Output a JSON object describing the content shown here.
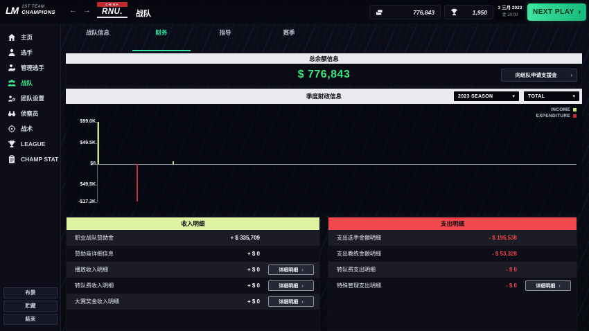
{
  "icons": {
    "chevron_right": "›",
    "chevron_down": "▾",
    "back_arrow": "←",
    "forward_arrow": "→"
  },
  "topbar": {
    "app_logo": {
      "monogram": "LM",
      "line1": "1ST TEAM",
      "line2": "CHAMPIONS"
    },
    "team": {
      "banner": "CHINA",
      "logo": "RNU.",
      "page_title": "战队"
    },
    "resources": {
      "money": "776,843",
      "tokens": "1,950"
    },
    "date": {
      "line1": "3 三月 2023",
      "line2": "金 20:00"
    },
    "next_play_label": "NEXT PLAY"
  },
  "sidebar": {
    "items": [
      {
        "label": "主页",
        "icon": "home"
      },
      {
        "label": "选手",
        "icon": "player"
      },
      {
        "label": "管理选手",
        "icon": "manage-players"
      },
      {
        "label": "战队",
        "icon": "team",
        "active": true
      },
      {
        "label": "团队设置",
        "icon": "team-settings"
      },
      {
        "label": "侦察员",
        "icon": "scout"
      },
      {
        "label": "战术",
        "icon": "tactics"
      },
      {
        "label": "LEAGUE",
        "icon": "league"
      },
      {
        "label": "CHAMP STAT",
        "icon": "champ-stat"
      }
    ],
    "footer_buttons": [
      "布景",
      "贮藏",
      "結束"
    ]
  },
  "tabs": [
    {
      "label": "战队信息",
      "active": false
    },
    {
      "label": "财务",
      "active": true
    },
    {
      "label": "指导",
      "active": false
    },
    {
      "label": "赛季",
      "active": false
    }
  ],
  "balance": {
    "header": "总余额信息",
    "amount": "$ 776,843",
    "request_button": "向组队申请支援金"
  },
  "finance_section": {
    "header": "季度财政信息",
    "season_select": "2023 SEASON",
    "scope_select": "TOTAL"
  },
  "chart_data": {
    "type": "bar",
    "title": "季度财政信息",
    "legend": [
      {
        "label": "INCOME",
        "color": "#cde37c"
      },
      {
        "label": "EXPENDITURE",
        "color": "#c22f3c"
      }
    ],
    "legend_position": "top-right",
    "y_tick_labels": [
      "$99.0K",
      "$49.5K",
      "$0",
      "$49.5K",
      "-$17.3K"
    ],
    "x_tick_labels": [],
    "grid": false,
    "bars": [
      {
        "series": "INCOME",
        "x_frac": 0.002,
        "height_frac": 1.0,
        "approx_value": 99000
      },
      {
        "series": "EXPENDITURE",
        "x_frac": 0.083,
        "height_frac": -1.0,
        "approx_value": -173000
      },
      {
        "series": "INCOME",
        "x_frac": 0.158,
        "height_frac": 0.07,
        "approx_value": 3000
      }
    ]
  },
  "income": {
    "header": "收入明细",
    "detail_button_label": "详细明细",
    "rows": [
      {
        "label": "职业战队赞助金",
        "value": "+ $ 335,709",
        "has_button": false
      },
      {
        "label": "赞助商详细信息",
        "value": "+ $ 0",
        "has_button": false
      },
      {
        "label": "播放收入明细",
        "value": "+ $ 0",
        "has_button": true
      },
      {
        "label": "转队费收入明细",
        "value": "+ $ 0",
        "has_button": true
      },
      {
        "label": "大赛奖金收入明细",
        "value": "+ $ 0",
        "has_button": true
      }
    ]
  },
  "expenditure": {
    "header": "支出明细",
    "detail_button_label": "详细明细",
    "rows": [
      {
        "label": "支出选手金额明细",
        "value": "- $ 195,538",
        "has_button": false
      },
      {
        "label": "支出教练金额明细",
        "value": "- $ 53,328",
        "has_button": false
      },
      {
        "label": "转队费支出明细",
        "value": "- $ 0",
        "has_button": false
      },
      {
        "label": "特殊管理支出明细",
        "value": "- $ 0",
        "has_button": true
      }
    ]
  },
  "colors": {
    "accent_green": "#2fe3a6",
    "balance_green": "#3ce87f",
    "income_header_bg": "#ddf3a2",
    "expenditure_header_bg": "#f2484d",
    "expenditure_value_red": "#f04449",
    "next_play_gradient": [
      "#3fe6a0",
      "#17b87b"
    ],
    "income_bar": "#cde37c",
    "expenditure_bar": "#c22f3c"
  }
}
